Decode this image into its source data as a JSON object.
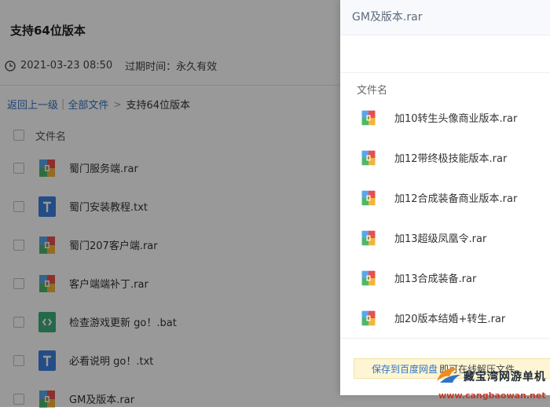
{
  "background": {
    "title": "支持64位版本",
    "meta": {
      "date": "2021-03-23 08:50",
      "expiry": "过期时间：永久有效"
    },
    "breadcrumb": {
      "back": "返回上一级",
      "all_files": "全部文件",
      "current": "支持64位版本"
    },
    "list_header": "文件名",
    "files": [
      {
        "name": "蜀门服务端.rar",
        "icon": "rar-archive-icon"
      },
      {
        "name": "蜀门安装教程.txt",
        "icon": "txt-file-icon"
      },
      {
        "name": "蜀门207客户端.rar",
        "icon": "rar-archive-icon"
      },
      {
        "name": "客户端端补丁.rar",
        "icon": "rar-archive-icon"
      },
      {
        "name": "检查游戏更新 go！.bat",
        "icon": "bat-script-icon"
      },
      {
        "name": "必看说明 go！.txt",
        "icon": "txt-file-icon"
      },
      {
        "name": "GM及版本.rar",
        "icon": "rar-archive-icon"
      }
    ]
  },
  "panel": {
    "title": "GM及版本.rar",
    "column_header": "文件名",
    "files": [
      {
        "name": "加10转生头像商业版本.rar"
      },
      {
        "name": "加12带终极技能版本.rar"
      },
      {
        "name": "加12合成装备商业版本.rar"
      },
      {
        "name": "加13超级凤凰令.rar"
      },
      {
        "name": "加13合成装备.rar"
      },
      {
        "name": "加20版本结婚+转生.rar"
      }
    ],
    "footer": {
      "save_label": "保存到百度网盘",
      "hint": "即可在线解压文件，"
    }
  },
  "watermark": {
    "text": "藏宝湾网游单机",
    "url": "www.cangbaowan.net"
  },
  "colors": {
    "link": "#2f73c7",
    "overlay": "rgba(0,0,0,0.40)",
    "footer_bg": "#fdf5d3"
  }
}
